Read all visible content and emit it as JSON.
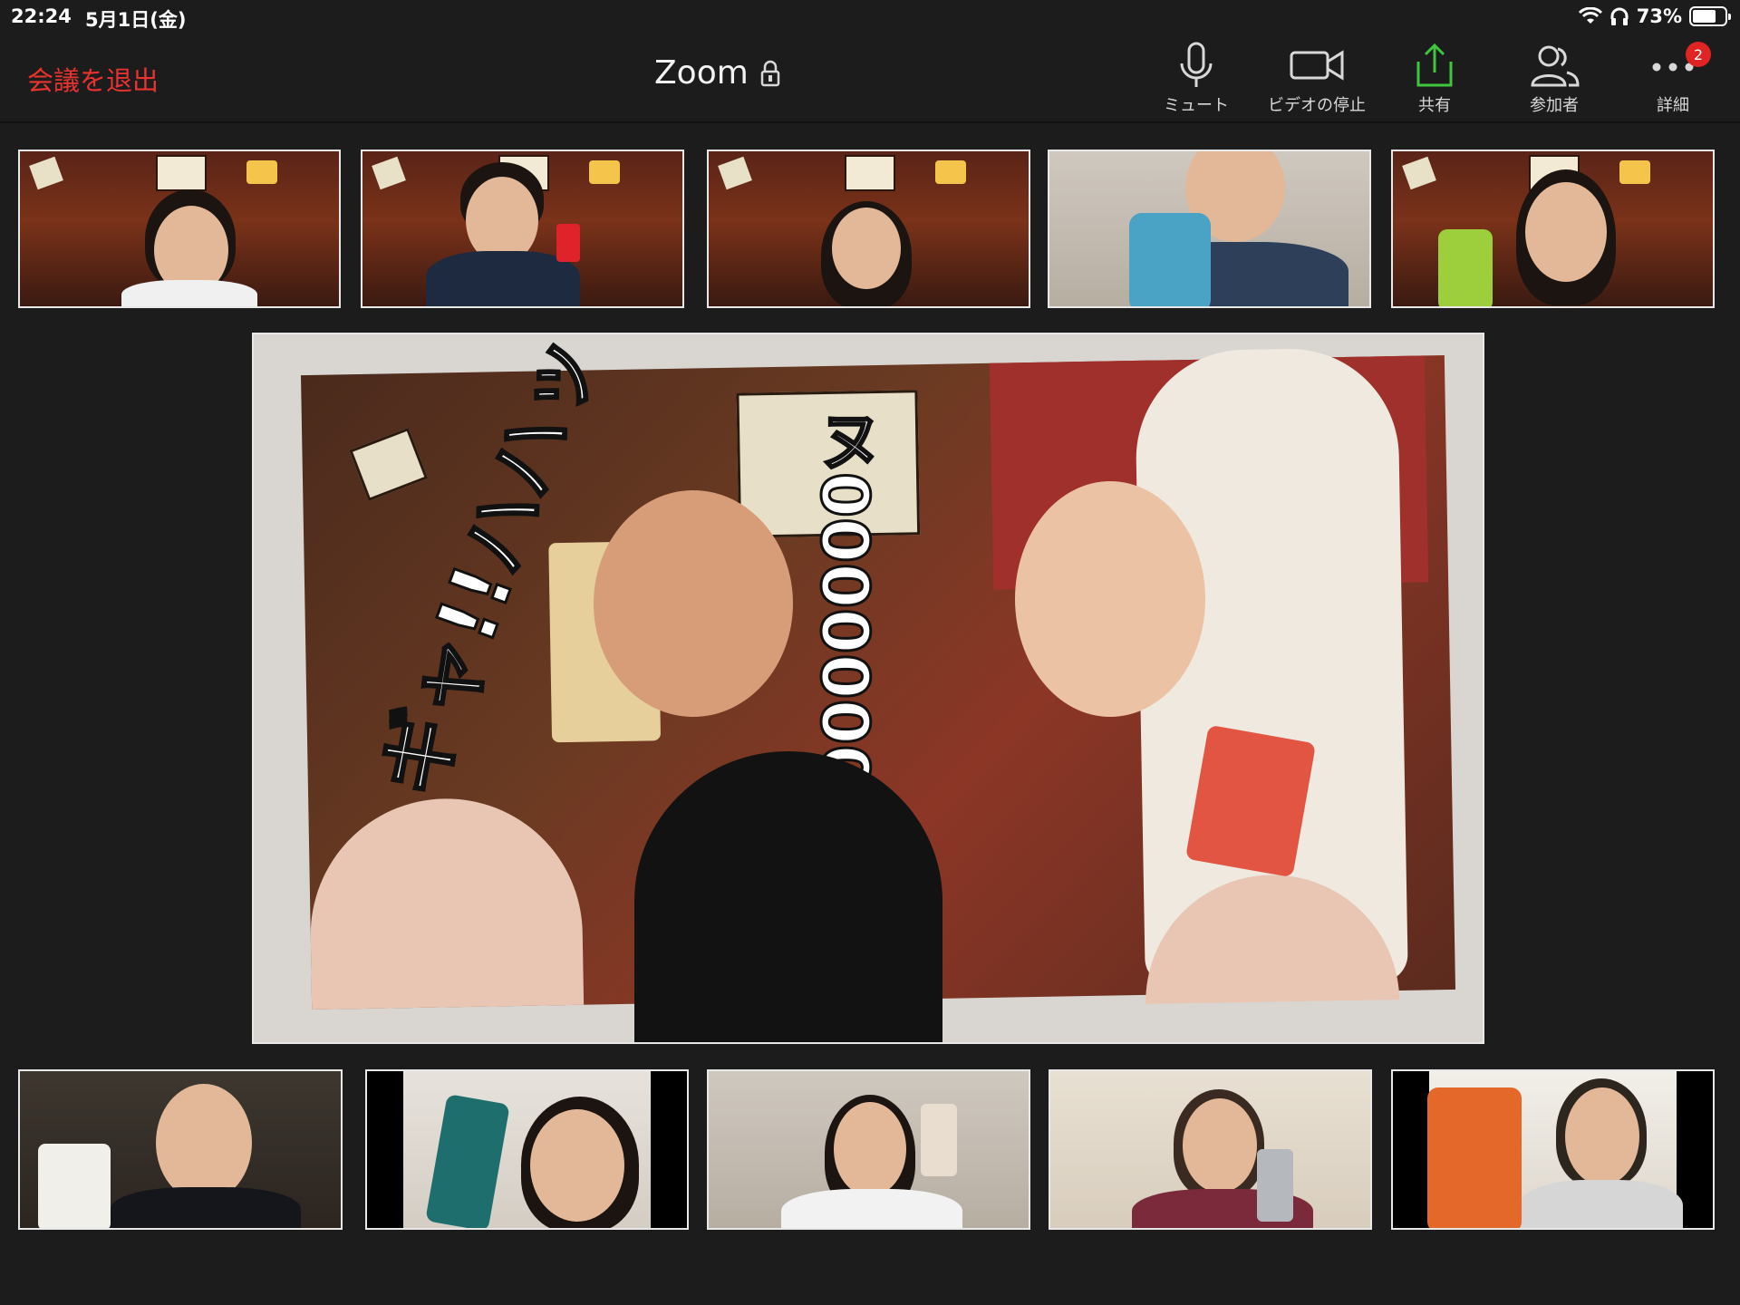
{
  "status_bar": {
    "time": "22:24",
    "date": "5月1日(金)",
    "battery": "73%",
    "battery_level": 0.73
  },
  "header": {
    "leave_label": "会議を退出",
    "title": "Zoom",
    "toolbar": {
      "mute_label": "ミュート",
      "video_label": "ビデオの停止",
      "share_label": "共有",
      "participants_label": "参加者",
      "more_label": "詳細",
      "more_badge": "2"
    }
  },
  "main_video": {
    "manga_text_left": "ギャ!!ハハッ",
    "manga_text_right": "ヌ0000000"
  },
  "colors": {
    "leave": "#e8332f",
    "share": "#3ec63e",
    "badge": "#e02424",
    "background": "#1c1c1c"
  }
}
